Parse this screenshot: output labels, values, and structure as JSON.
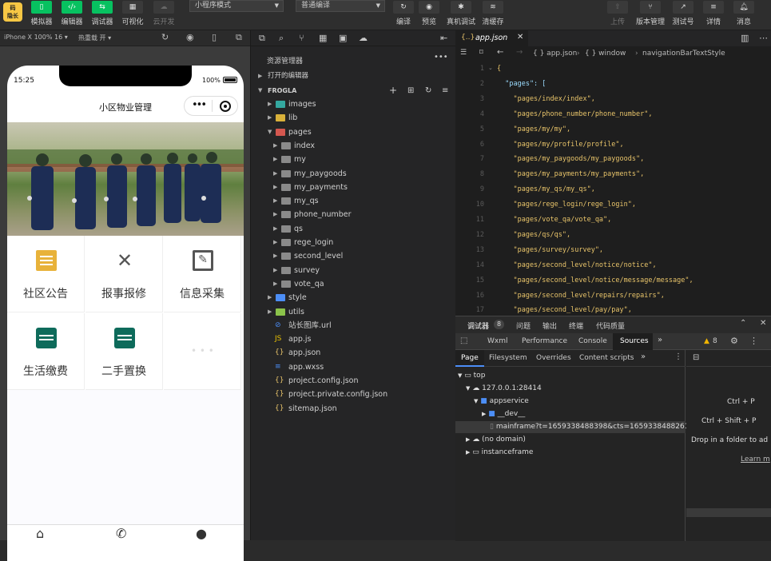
{
  "toolbar": {
    "logo": "码\n隐长",
    "simulator": "模拟器",
    "editor": "编辑器",
    "debugger": "调试器",
    "visual": "可视化",
    "cloud": "云开发",
    "mode_select": "小程序模式",
    "compile_select": "普通编译",
    "compile": "编译",
    "preview": "预览",
    "realdebug": "真机调试",
    "clearcache": "清缓存",
    "upload": "上传",
    "version": "版本管理",
    "test": "测试号",
    "details": "详情",
    "messages": "消息",
    "accent": "#07c160"
  },
  "simbar": {
    "device": "iPhone X 100% 16 ▾",
    "hotreload": "热重载 开 ▾"
  },
  "phone": {
    "time": "15:25",
    "battery": "100%",
    "title": "小区物业管理",
    "grid": [
      "社区公告",
      "报事报修",
      "信息采集",
      "生活缴费",
      "二手置换"
    ],
    "grid_icons": [
      "notice-icon",
      "tools-icon",
      "edit-icon",
      "wallet-icon",
      "wallet-icon"
    ]
  },
  "explorer": {
    "title": "资源管理器",
    "open_editors": "打开的编辑器",
    "project": "FROGLA",
    "items": [
      {
        "name": "images",
        "type": "folder-img",
        "depth": 1,
        "open": false
      },
      {
        "name": "lib",
        "type": "folder-lib",
        "depth": 1,
        "open": false
      },
      {
        "name": "pages",
        "type": "folder-pages",
        "depth": 1,
        "open": true
      },
      {
        "name": "index",
        "type": "folder",
        "depth": 2,
        "open": false
      },
      {
        "name": "my",
        "type": "folder",
        "depth": 2,
        "open": false
      },
      {
        "name": "my_paygoods",
        "type": "folder",
        "depth": 2,
        "open": false
      },
      {
        "name": "my_payments",
        "type": "folder",
        "depth": 2,
        "open": false
      },
      {
        "name": "my_qs",
        "type": "folder",
        "depth": 2,
        "open": false
      },
      {
        "name": "phone_number",
        "type": "folder",
        "depth": 2,
        "open": false
      },
      {
        "name": "qs",
        "type": "folder",
        "depth": 2,
        "open": false
      },
      {
        "name": "rege_login",
        "type": "folder",
        "depth": 2,
        "open": false
      },
      {
        "name": "second_level",
        "type": "folder",
        "depth": 2,
        "open": false
      },
      {
        "name": "survey",
        "type": "folder",
        "depth": 2,
        "open": false
      },
      {
        "name": "vote_qa",
        "type": "folder",
        "depth": 2,
        "open": false
      },
      {
        "name": "style",
        "type": "folder-style",
        "depth": 1,
        "open": false
      },
      {
        "name": "utils",
        "type": "folder-utils",
        "depth": 1,
        "open": false
      },
      {
        "name": "站长图库.url",
        "type": "url",
        "depth": 1
      },
      {
        "name": "app.js",
        "type": "js",
        "depth": 1
      },
      {
        "name": "app.json",
        "type": "json",
        "depth": 1
      },
      {
        "name": "app.wxss",
        "type": "wxss",
        "depth": 1
      },
      {
        "name": "project.config.json",
        "type": "json",
        "depth": 1
      },
      {
        "name": "project.private.config.json",
        "type": "json",
        "depth": 1
      },
      {
        "name": "sitemap.json",
        "type": "json",
        "depth": 1
      }
    ]
  },
  "editor": {
    "tab": "app.json",
    "breadcrumb": [
      "{ } app.json",
      "{ } window",
      "navigationBarTextStyle"
    ],
    "line_numbers": [
      "1",
      "2",
      "3",
      "4",
      "5",
      "6",
      "7",
      "8",
      "9",
      "10",
      "11",
      "12",
      "13",
      "14",
      "15",
      "16",
      "17"
    ],
    "lines": [
      "{",
      "  \"pages\": [",
      "    \"pages/index/index\",",
      "    \"pages/phone_number/phone_number\",",
      "    \"pages/my/my\",",
      "    \"pages/my/profile/profile\",",
      "    \"pages/my_paygoods/my_paygoods\",",
      "    \"pages/my_payments/my_payments\",",
      "    \"pages/my_qs/my_qs\",",
      "    \"pages/rege_login/rege_login\",",
      "    \"pages/vote_qa/vote_qa\",",
      "    \"pages/qs/qs\",",
      "    \"pages/survey/survey\",",
      "    \"pages/second_level/notice/notice\",",
      "    \"pages/second_level/notice/message/message\",",
      "    \"pages/second_level/repairs/repairs\",",
      "    \"pages/second_level/pay/pay\","
    ]
  },
  "devtools": {
    "tabs": [
      "调试器",
      "问题",
      "输出",
      "终端",
      "代码质量"
    ],
    "badge": "8",
    "panels": [
      "Wxml",
      "Performance",
      "Console",
      "Sources"
    ],
    "warn_count": "8",
    "subtabs": [
      "Page",
      "Filesystem",
      "Overrides",
      "Content scripts"
    ],
    "tree": [
      "top",
      "127.0.0.1:28414",
      "appservice",
      "__dev__",
      "mainframe?t=1659338488398&cts=1659338488261",
      "(no domain)",
      "instanceframe"
    ],
    "shortcuts": [
      "Ctrl + P",
      "Ctrl + Shift + P",
      "Drop in a folder to ad",
      "Learn m"
    ]
  }
}
